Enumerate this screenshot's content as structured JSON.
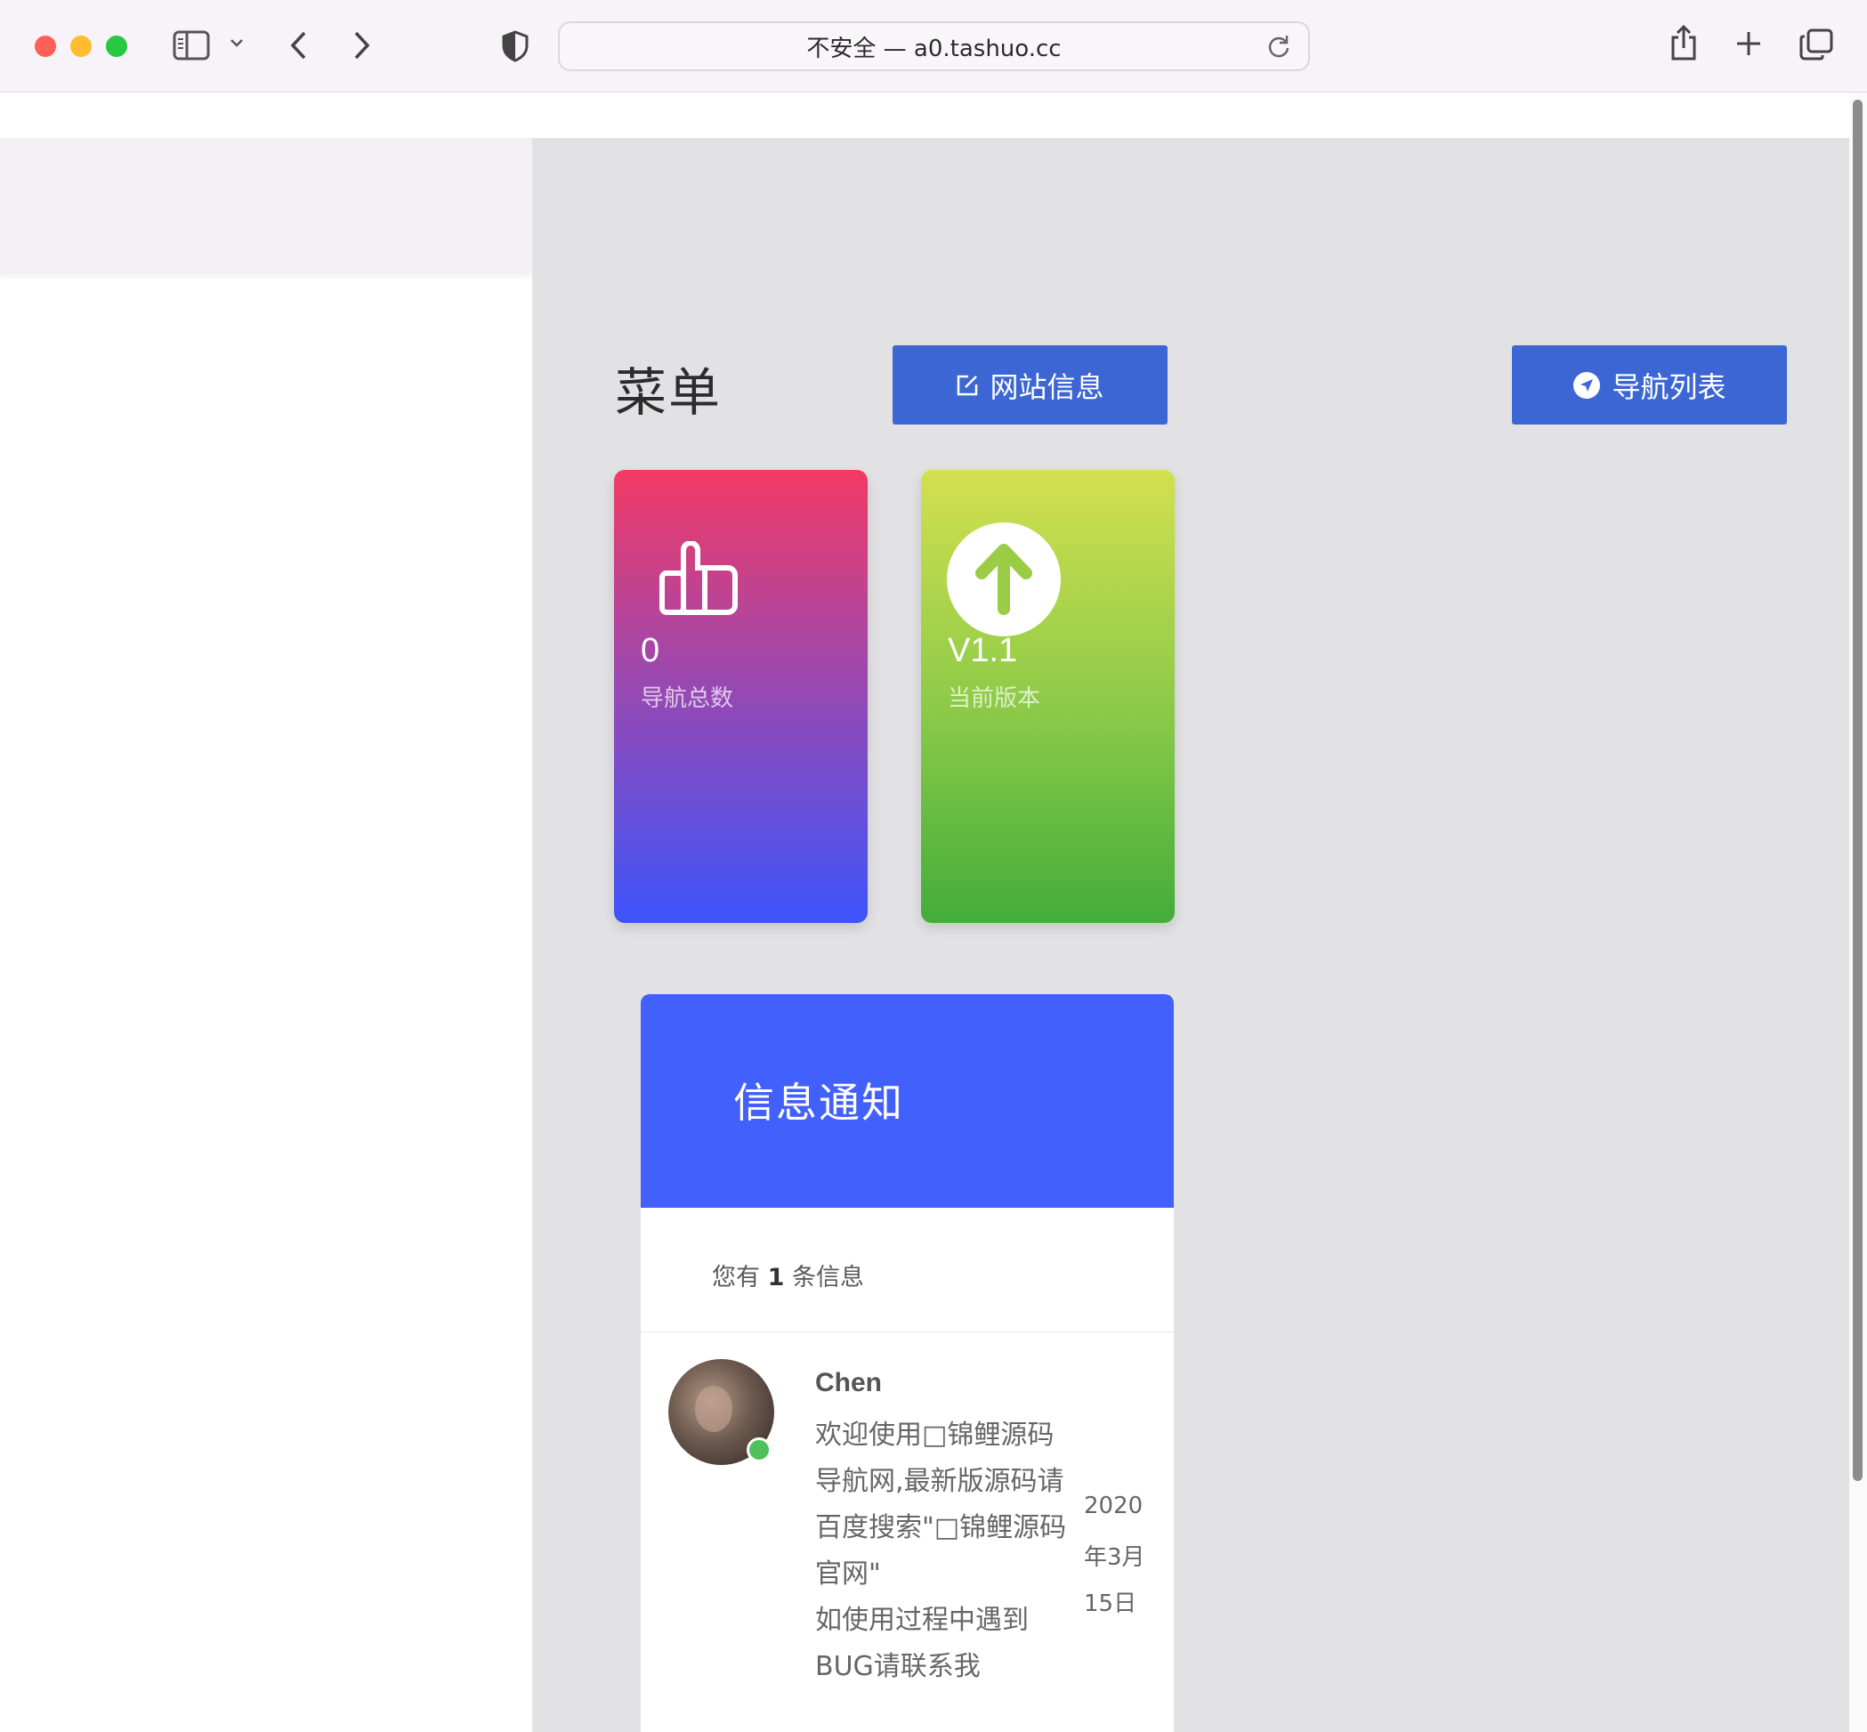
{
  "browser": {
    "url_text": "不安全 — a0.tashuo.cc"
  },
  "colors": {
    "button_blue": "#3c66d3",
    "notice_header_blue": "#4260fb",
    "online_green": "#4fc05a"
  },
  "page": {
    "menu_title": "菜单",
    "buttons": {
      "site_info": "网站信息",
      "nav_list": "导航列表"
    },
    "stats": [
      {
        "value": "0",
        "label": "导航总数",
        "icon": "thumbs-up-icon"
      },
      {
        "value": "V1.1",
        "label": "当前版本",
        "icon": "arrow-up-circle-icon"
      }
    ],
    "notice": {
      "title": "信息通知",
      "count_prefix": "您有",
      "count": "1",
      "count_suffix": "条信息",
      "message": {
        "author": "Chen",
        "lines": [
          "欢迎使用□锦鲤源码",
          "导航网,最新版源码请",
          "百度搜索\"□锦鲤源码",
          "官网\"",
          "如使用过程中遇到",
          "BUG请联系我"
        ],
        "date_lines": [
          "2020",
          "年3月",
          "15日"
        ]
      }
    }
  }
}
